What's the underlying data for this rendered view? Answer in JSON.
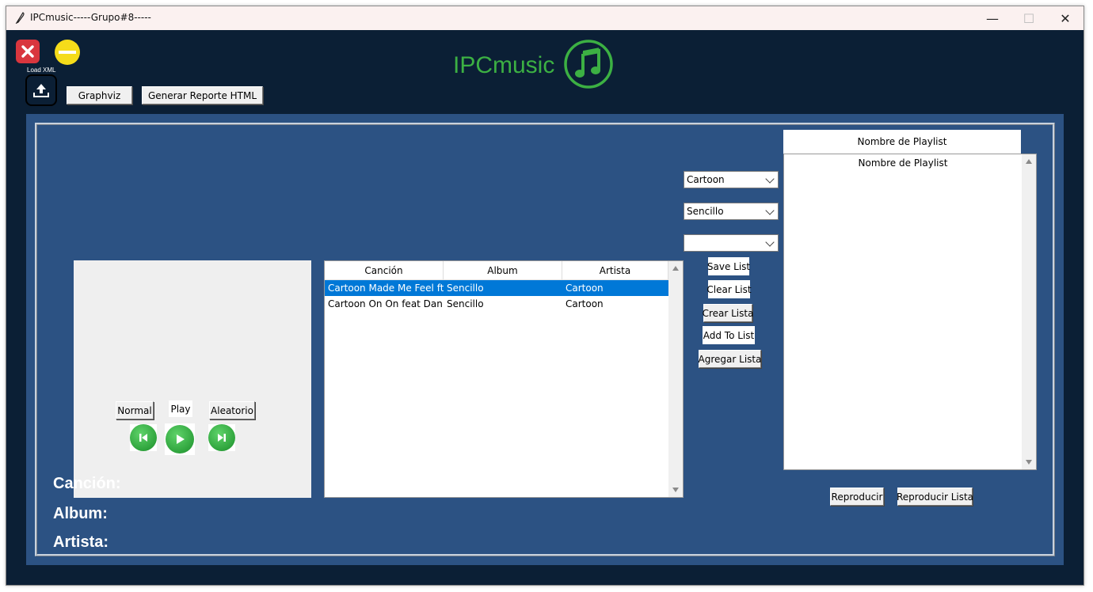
{
  "window": {
    "title": "IPCmusic-----Grupo#8-----",
    "minimize_glyph": "—",
    "maximize_glyph": "☐",
    "close_glyph": "✕"
  },
  "header": {
    "logo_text": "IPCmusic",
    "logo_icon": "music-note-icon",
    "logo_color": "#3cb043",
    "load_xml_label": "Load XML",
    "graphviz_label": "Graphviz",
    "report_label": "Generar Reporte HTML"
  },
  "table": {
    "columns": [
      "Canción",
      "Album",
      "Artista"
    ],
    "rows": [
      {
        "cancion": "Cartoon  Made Me Feel ft K",
        "album": "Sencillo",
        "artista": "Cartoon",
        "selected": true
      },
      {
        "cancion": "Cartoon  On  On feat Danie",
        "album": "Sencillo",
        "artista": "Cartoon",
        "selected": false
      }
    ]
  },
  "controls": {
    "normal_label": "Normal",
    "play_label": "Play",
    "aleatorio_label": "Aleatorio"
  },
  "filters": {
    "artist_value": "Cartoon",
    "album_value": "Sencillo",
    "third_value": "",
    "save_list": "Save List",
    "clear_list": "Clear List",
    "crear_lista": "Crear Lista",
    "add_to_list": "Add To List",
    "agregar_lista": "Agregar Lista"
  },
  "playlist": {
    "header": "Nombre de Playlist",
    "items": [
      "Nombre de Playlist"
    ],
    "reproducir": "Reproducir",
    "reproducir_lista": "Reproducir Lista"
  },
  "now_playing": {
    "cancion_label": "Canción:",
    "album_label": "Album:",
    "artista_label": "Artista:"
  },
  "colors": {
    "background": "#0b1f35",
    "panel": "#2c5283",
    "selection": "#0078d7",
    "green": "#3cb043",
    "close_red": "#d9363e",
    "minimize_yellow": "#f5dc1a"
  }
}
